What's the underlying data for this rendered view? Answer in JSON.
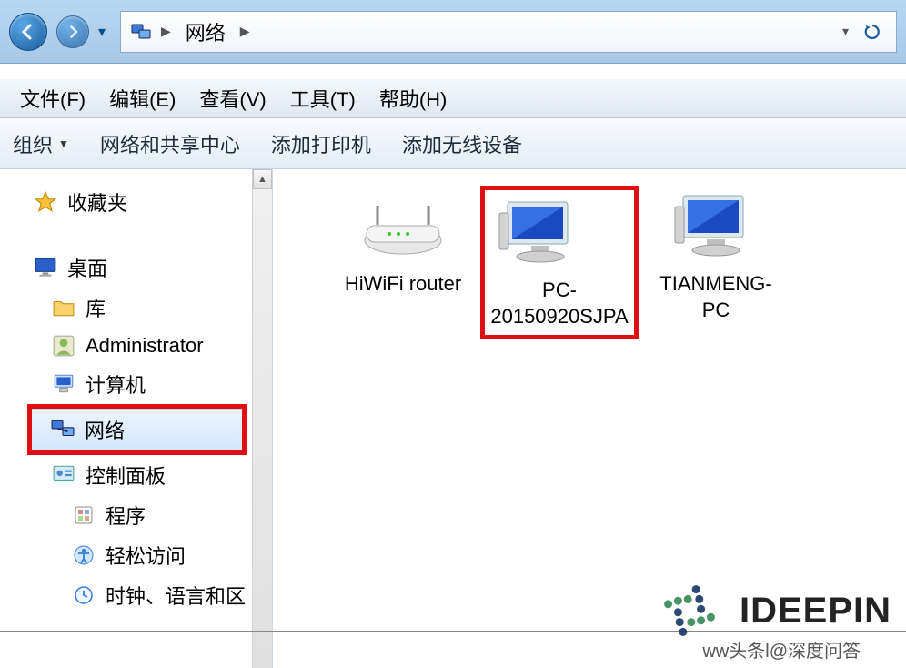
{
  "navigation": {
    "location_icon": "network",
    "crumb": "网络"
  },
  "menu": {
    "file": "文件(F)",
    "edit": "编辑(E)",
    "view": "查看(V)",
    "tools": "工具(T)",
    "help": "帮助(H)"
  },
  "commands": {
    "organize": "组织",
    "network_center": "网络和共享中心",
    "add_printer": "添加打印机",
    "add_wireless": "添加无线设备"
  },
  "tree": {
    "favorites": "收藏夹",
    "desktop": "桌面",
    "libraries": "库",
    "user": "Administrator",
    "computer": "计算机",
    "network": "网络",
    "control_panel": "控制面板",
    "programs": "程序",
    "ease_of_access": "轻松访问",
    "clock_lang_region": "时钟、语言和区"
  },
  "items": [
    {
      "key": "router",
      "label": "HiWiFi router",
      "type": "router",
      "highlighted": false
    },
    {
      "key": "pc1",
      "label": "PC-20150920SJPA",
      "type": "computer",
      "highlighted": true
    },
    {
      "key": "pc2",
      "label": "TIANMENG-PC",
      "type": "computer",
      "highlighted": false
    }
  ],
  "watermark": {
    "brand": "IDEEPIN",
    "tagline": "ww头条l@深度问答"
  }
}
